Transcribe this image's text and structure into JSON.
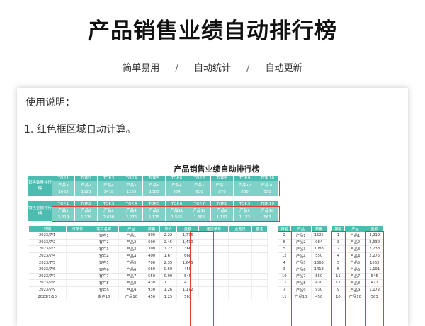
{
  "page": {
    "title": "产品销售业绩自动排行榜",
    "tags": [
      "简单易用",
      "自动统计",
      "自动更新"
    ],
    "separator": "/"
  },
  "usage": {
    "title": "使用说明：",
    "items": [
      "1. 红色框区域自动计算。"
    ]
  },
  "sheet": {
    "title": "产品销售业绩自动排行榜",
    "accent": "#4dbcb0",
    "highlight": "#e53935",
    "top_headers": [
      "TOP.1",
      "TOP.2",
      "TOP.3",
      "TOP.4",
      "TOP.5",
      "TOP.6",
      "TOP.7",
      "TOP.8",
      "TOP.9",
      "TOP.10"
    ],
    "qty_rank": {
      "label": "销售数量排行榜",
      "products": [
        "产品3",
        "产品2",
        "产品4",
        "产品5",
        "产品6",
        "产品4",
        "产品1",
        "产品11",
        "产品12",
        "产品10"
      ],
      "values": [
        "1663",
        "1525",
        "1418",
        "1255",
        "1088",
        "984",
        "930",
        "870",
        "866",
        "550"
      ]
    },
    "amount_rank": {
      "label": "销售金额排行榜",
      "products": [
        "产品1",
        "产品3",
        "产品2",
        "产品4",
        "产品5",
        "产品11",
        "产品12",
        "产品8",
        "产品9",
        "产品10"
      ],
      "values": [
        "3,219",
        "2,738",
        "2,630",
        "2,275",
        "2,175",
        "1,565",
        "1,365",
        "1,191",
        "1,172",
        "563"
      ]
    },
    "main_table": {
      "headers": [
        "日期",
        "订单号",
        "客户名称",
        "产品",
        "数量",
        "单价",
        "金额",
        "送货单号",
        "业务员",
        "备注"
      ],
      "rows": [
        [
          "2023/7/1",
          "",
          "客户1",
          "产品1",
          "800",
          "2.22",
          "1,776",
          "",
          "",
          ""
        ],
        [
          "2023/7/2",
          "",
          "客户2",
          "产品2",
          "600",
          "2.45",
          "1,470",
          "",
          "",
          ""
        ],
        [
          "2023/7/3",
          "",
          "客户3",
          "产品3",
          "300",
          "1.22",
          "366",
          "",
          "",
          ""
        ],
        [
          "2023/7/4",
          "",
          "客户4",
          "产品4",
          "400",
          "1.67",
          "668",
          "",
          "",
          ""
        ],
        [
          "2023/7/5",
          "",
          "客户5",
          "产品5",
          "700",
          "2.35",
          "1,645",
          "",
          "",
          ""
        ],
        [
          "2023/7/6",
          "",
          "客户6",
          "产品6",
          "660",
          "0.69",
          "455",
          "",
          "",
          ""
        ],
        [
          "2023/7/7",
          "",
          "客户7",
          "产品7",
          "550",
          "0.99",
          "545",
          "",
          "",
          ""
        ],
        [
          "2023/7/8",
          "",
          "客户8",
          "产品8",
          "430",
          "1.11",
          "477",
          "",
          "",
          ""
        ],
        [
          "2023/7/9",
          "",
          "客户9",
          "产品9",
          "930",
          "1.26",
          "1,172",
          "",
          "",
          ""
        ],
        [
          "2023/7/10",
          "",
          "客户10",
          "产品10",
          "450",
          "1.25",
          "563",
          "",
          "",
          ""
        ]
      ]
    },
    "qty_table": {
      "headers": [
        "排名",
        "产品",
        "数量"
      ],
      "rows": [
        [
          "2",
          "产品1",
          "1525"
        ],
        [
          "6",
          "产品2",
          "984"
        ],
        [
          "5",
          "产品3",
          "1088"
        ],
        [
          "12",
          "产品4",
          "550"
        ],
        [
          "4",
          "产品5",
          "1663"
        ],
        [
          "3",
          "产品6",
          "1418"
        ],
        [
          "10",
          "产品7",
          "550"
        ],
        [
          "11",
          "产品8",
          "430"
        ],
        [
          "7",
          "产品9",
          "930"
        ],
        [
          "11",
          "产品10",
          "450"
        ]
      ]
    },
    "amount_table": {
      "headers": [
        "排名",
        "产品",
        "金额"
      ],
      "rows": [
        [
          "1",
          "产品1",
          "3,219"
        ],
        [
          "3",
          "产品2",
          "2,630"
        ],
        [
          "2",
          "产品3",
          "2,738"
        ],
        [
          "4",
          "产品4",
          "2,275"
        ],
        [
          "5",
          "产品5",
          "1663"
        ],
        [
          "6",
          "产品6",
          "1,191"
        ],
        [
          "11",
          "产品7",
          "545"
        ],
        [
          "12",
          "产品8",
          "477"
        ],
        [
          "9",
          "产品9",
          "1,172"
        ],
        [
          "10",
          "产品10",
          "563"
        ]
      ]
    }
  }
}
